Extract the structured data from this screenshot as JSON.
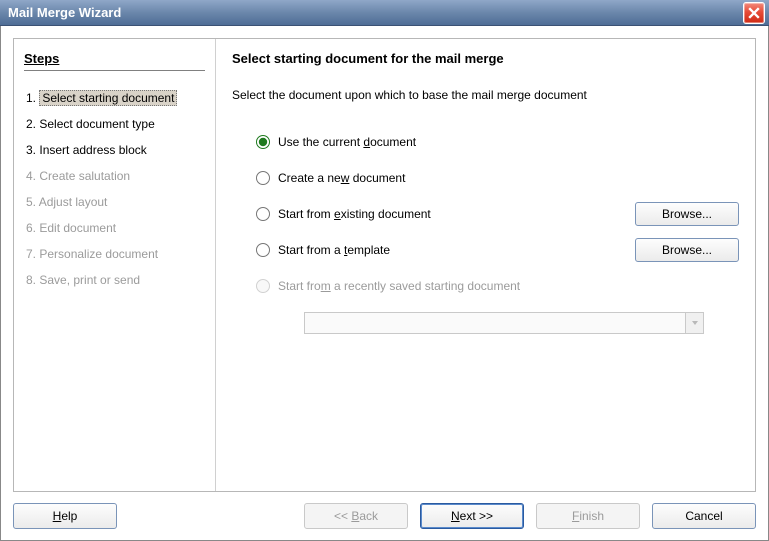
{
  "window": {
    "title": "Mail Merge Wizard"
  },
  "sidebar": {
    "heading": "Steps",
    "items": [
      {
        "n": "1.",
        "label": "Select starting document",
        "state": "selected"
      },
      {
        "n": "2.",
        "label": "Select document type",
        "state": "enabled"
      },
      {
        "n": "3.",
        "label": "Insert address block",
        "state": "enabled"
      },
      {
        "n": "4.",
        "label": "Create salutation",
        "state": "disabled"
      },
      {
        "n": "5.",
        "label": "Adjust layout",
        "state": "disabled"
      },
      {
        "n": "6.",
        "label": "Edit document",
        "state": "disabled"
      },
      {
        "n": "7.",
        "label": "Personalize document",
        "state": "disabled"
      },
      {
        "n": "8.",
        "label": "Save, print or send",
        "state": "disabled"
      }
    ]
  },
  "content": {
    "heading": "Select starting document for the mail merge",
    "subtext": "Select the document upon which to base the mail merge document",
    "radios": {
      "current": {
        "pre": "Use the current ",
        "u": "d",
        "post": "ocument"
      },
      "new": {
        "pre": "Create a ne",
        "u": "w",
        "post": " document"
      },
      "existing": {
        "pre": "Start from ",
        "u": "e",
        "post": "xisting document"
      },
      "template": {
        "pre": "Start from a ",
        "u": "t",
        "post": "emplate"
      },
      "recent": {
        "pre": "Start fro",
        "u": "m",
        "post": " a recently saved starting document"
      }
    },
    "browse_label": "Browse...",
    "recent_value": ""
  },
  "buttons": {
    "help": {
      "pre": "",
      "u": "H",
      "post": "elp"
    },
    "back": {
      "pre": "<< ",
      "u": "B",
      "post": "ack"
    },
    "next": {
      "pre": "",
      "u": "N",
      "post": "ext >>"
    },
    "finish": {
      "pre": "",
      "u": "F",
      "post": "inish"
    },
    "cancel": "Cancel"
  }
}
